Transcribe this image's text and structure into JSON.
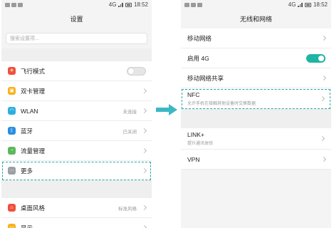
{
  "status_bar": {
    "signal": "4G",
    "time": "18:52"
  },
  "colors": {
    "accent": "#1fb5a5",
    "highlight": "#2aa6a6"
  },
  "left": {
    "title": "设置",
    "search_placeholder": "搜索设置项...",
    "group1": [
      {
        "label": "飞行模式",
        "icon": "airplane-icon",
        "control": "toggle-off",
        "color": "#f0503c"
      },
      {
        "label": "双卡管理",
        "icon": "sim-card-icon",
        "color": "#f7b21a"
      },
      {
        "label": "WLAN",
        "icon": "wifi-icon",
        "value": "未连接",
        "color": "#2eaee0"
      },
      {
        "label": "蓝牙",
        "icon": "bluetooth-icon",
        "value": "已关闭",
        "color": "#2a8ee0"
      },
      {
        "label": "流量管理",
        "icon": "data-usage-icon",
        "color": "#5cb85c"
      },
      {
        "label": "更多",
        "icon": "more-icon",
        "color": "#9aa0a6",
        "highlighted": true
      }
    ],
    "group2": [
      {
        "label": "桌面风格",
        "icon": "home-screen-icon",
        "value": "标准风格",
        "color": "#f0503c"
      },
      {
        "label": "显示",
        "icon": "display-icon",
        "color": "#f7b21a"
      }
    ]
  },
  "right": {
    "title": "无线和网络",
    "group1": [
      {
        "label": "移动网络"
      },
      {
        "label": "启用 4G",
        "control": "toggle-on"
      },
      {
        "label": "移动网络共享"
      },
      {
        "label": "NFC",
        "sub": "允许手机在接触其他设备时交换数据",
        "highlighted": true
      }
    ],
    "group2": [
      {
        "label": "LINK+",
        "sub": "提升通讯体验"
      },
      {
        "label": "VPN"
      }
    ]
  }
}
